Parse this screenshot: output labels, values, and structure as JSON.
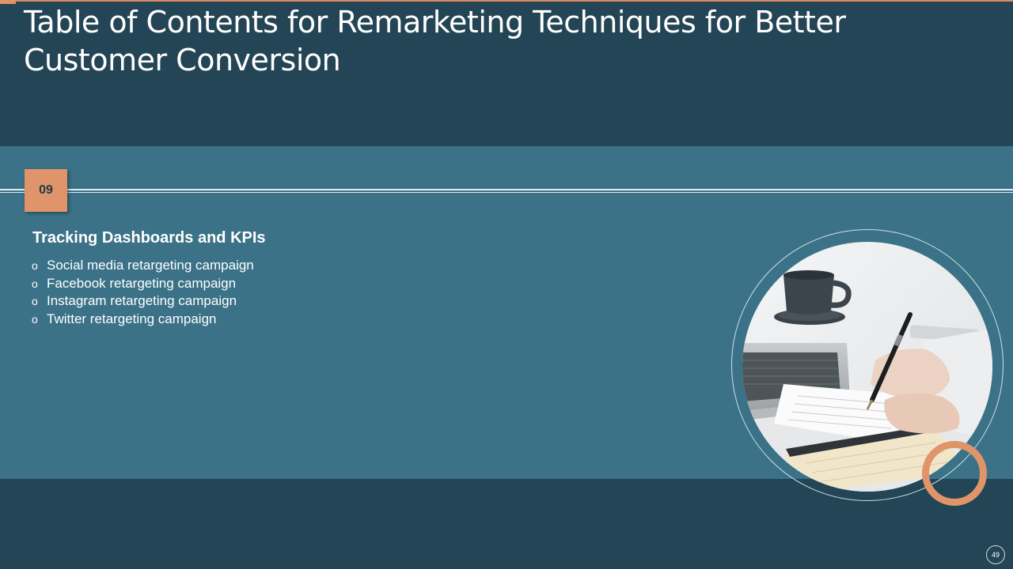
{
  "title": "Table of Contents for Remarketing Techniques for Better Customer Conversion",
  "section": {
    "number": "09",
    "heading": "Tracking Dashboards and KPIs",
    "bullet_marker": "o",
    "items": [
      "Social media retargeting campaign",
      "Facebook retargeting campaign",
      "Instagram retargeting campaign",
      "Twitter retargeting campaign"
    ]
  },
  "page_number": "49",
  "colors": {
    "dark_teal": "#234555",
    "mid_teal": "#3b7287",
    "accent_orange": "#e0946a",
    "text": "#ffffff"
  }
}
